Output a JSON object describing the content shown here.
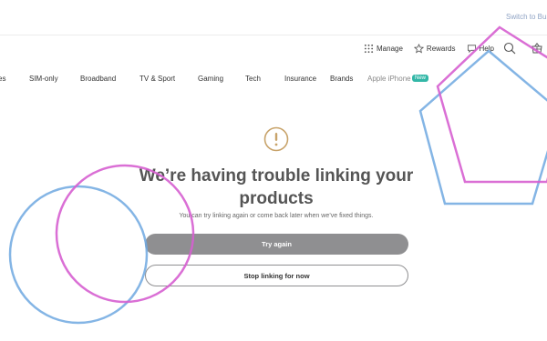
{
  "header": {
    "switch_link": "Switch to Bus"
  },
  "utility": {
    "manage": "Manage",
    "rewards": "Rewards",
    "help": "Help"
  },
  "nav": {
    "items": [
      "es",
      "SIM-only",
      "Broadband",
      "TV & Sport",
      "Gaming",
      "Tech",
      "Insurance",
      "Brands",
      "Apple iPhone"
    ],
    "badge": "New"
  },
  "error": {
    "title_line1": "We’re having trouble linking your",
    "title_line2": "products",
    "subtitle": "You can try linking again or come back later when we’ve fixed things."
  },
  "actions": {
    "try_again": "Try again",
    "stop_linking": "Stop linking for now"
  },
  "colors": {
    "accent_gray": "#8f8f91",
    "badge_teal": "#32b7a7",
    "alert_gold": "#c8a36a",
    "deco_pink": "#d65fd0",
    "deco_blue": "#6ea8e0"
  },
  "icons": {
    "manage": "grid-icon",
    "rewards": "star-icon",
    "help": "chat-bubble-icon",
    "search": "search-icon",
    "basket": "basket-icon",
    "alert": "alert-circle-icon"
  }
}
